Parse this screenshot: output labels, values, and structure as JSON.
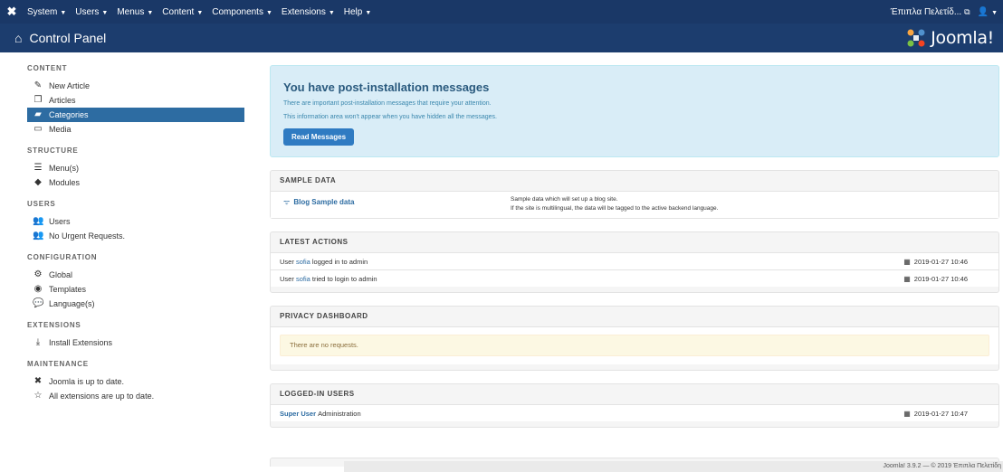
{
  "topbar": {
    "menu": [
      {
        "label": "System"
      },
      {
        "label": "Users"
      },
      {
        "label": "Menus"
      },
      {
        "label": "Content"
      },
      {
        "label": "Components"
      },
      {
        "label": "Extensions"
      },
      {
        "label": "Help"
      }
    ],
    "site_name": "Έπιπλα Πελετίδ...",
    "user_icon": "user-icon"
  },
  "header": {
    "title": "Control Panel",
    "brand": "Joomla!"
  },
  "sidebar": {
    "sections": [
      {
        "title": "CONTENT",
        "items": [
          {
            "label": "New Article",
            "icon": "pencil-icon"
          },
          {
            "label": "Articles",
            "icon": "stack-icon"
          },
          {
            "label": "Categories",
            "icon": "folder-icon"
          },
          {
            "label": "Media",
            "icon": "image-icon"
          }
        ]
      },
      {
        "title": "STRUCTURE",
        "items": [
          {
            "label": "Menu(s)",
            "icon": "list-icon"
          },
          {
            "label": "Modules",
            "icon": "cube-icon"
          }
        ]
      },
      {
        "title": "USERS",
        "items": [
          {
            "label": "Users",
            "icon": "users-icon"
          },
          {
            "label": "No Urgent Requests.",
            "icon": "users-icon"
          }
        ]
      },
      {
        "title": "CONFIGURATION",
        "items": [
          {
            "label": "Global",
            "icon": "cog-icon"
          },
          {
            "label": "Templates",
            "icon": "eye-icon"
          },
          {
            "label": "Language(s)",
            "icon": "comments-icon"
          }
        ]
      },
      {
        "title": "EXTENSIONS",
        "items": [
          {
            "label": "Install Extensions",
            "icon": "upload-icon"
          }
        ]
      },
      {
        "title": "MAINTENANCE",
        "items": [
          {
            "label": "Joomla is up to date.",
            "icon": "joomla-icon"
          },
          {
            "label": "All extensions are up to date.",
            "icon": "star-icon"
          }
        ]
      }
    ]
  },
  "alert": {
    "title": "You have post-installation messages",
    "line1": "There are important post-installation messages that require your attention.",
    "line2": "This information area won't appear when you have hidden all the messages.",
    "button": "Read Messages"
  },
  "sample_data": {
    "heading": "SAMPLE DATA",
    "name": "Blog Sample data",
    "desc1": "Sample data which will set up a blog site.",
    "desc2": "If the site is multilingual, the data will be tagged to the active backend language."
  },
  "latest_actions": {
    "heading": "LATEST ACTIONS",
    "rows": [
      {
        "prefix": "User",
        "user": "sofia",
        "suffix": "logged in to admin",
        "date": "2019-01-27 10:46"
      },
      {
        "prefix": "User",
        "user": "sofia",
        "suffix": "tried to login to admin",
        "date": "2019-01-27 10:46"
      }
    ]
  },
  "privacy": {
    "heading": "PRIVACY DASHBOARD",
    "message": "There are no requests."
  },
  "logged_in": {
    "heading": "LOGGED-IN USERS",
    "user": "Super User",
    "role": "Administration",
    "date": "2019-01-27 10:47"
  },
  "footer": {
    "text": "Joomla! 3.9.2 — © 2019 Έπιπλα Πελετίδη"
  }
}
